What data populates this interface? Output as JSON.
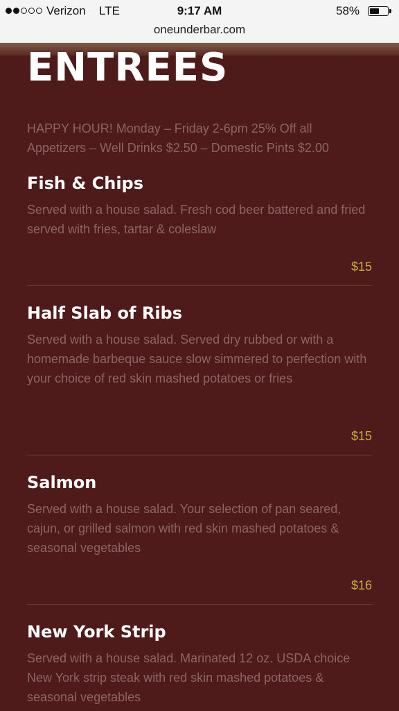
{
  "status_bar": {
    "signal_dots_filled": 2,
    "signal_dots_total": 5,
    "carrier": "Verizon",
    "network": "LTE",
    "time": "9:17 AM",
    "battery_percent_label": "58%",
    "battery_level": 0.58
  },
  "browser": {
    "url": "oneunderbar.com"
  },
  "page": {
    "title": "ENTREES",
    "happy_hour": "HAPPY HOUR! Monday – Friday 2-6pm 25% Off all Appetizers – Well Drinks $2.50 – Domestic Pints $2.00"
  },
  "items": [
    {
      "name": "Fish & Chips",
      "description": "Served with a house salad. Fresh cod beer battered and fried served with fries, tartar & coleslaw",
      "price": "$15"
    },
    {
      "name": "Half Slab of Ribs",
      "description": "Served with a house salad. Served dry rubbed or with a homemade barbeque sauce slow simmered to perfection with your choice of red skin mashed potatoes or fries",
      "price": "$15"
    },
    {
      "name": "Salmon",
      "description": "Served with a house salad. Your selection of pan seared, cajun, or grilled salmon with red skin mashed potatoes & seasonal vegetables",
      "price": "$16"
    },
    {
      "name": "New York Strip",
      "description": "Served with a house salad. Marinated 12 oz. USDA choice New York strip steak with red skin mashed potatoes & seasonal vegetables",
      "price": ""
    }
  ],
  "colors": {
    "background": "#4e1a1a",
    "title": "#ffffff",
    "description": "#8b6664",
    "price": "#c8b040"
  }
}
